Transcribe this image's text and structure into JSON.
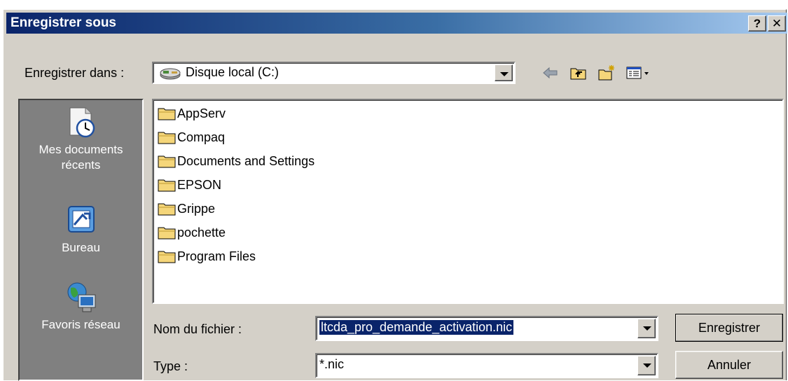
{
  "window": {
    "title": "Enregistrer sous",
    "help_label": "?",
    "close_label": "✕"
  },
  "save_in": {
    "label": "Enregistrer dans :",
    "value": "Disque local (C:)",
    "icon": "drive-icon"
  },
  "toolbar": {
    "back": "back-arrow-icon",
    "up": "up-folder-icon",
    "new_folder": "new-folder-icon",
    "view": "view-menu-icon"
  },
  "places": [
    {
      "label": "Mes documents récents",
      "icon": "recent-documents-icon"
    },
    {
      "label": "Bureau",
      "icon": "desktop-icon"
    },
    {
      "label": "Favoris réseau",
      "icon": "network-icon"
    }
  ],
  "files": [
    "AppServ",
    "Compaq",
    "Documents and Settings",
    "EPSON",
    "Grippe",
    "pochette",
    "Program Files"
  ],
  "filename": {
    "label": "Nom du fichier :",
    "value": "ltcda_pro_demande_activation.nic"
  },
  "filetype": {
    "label": "Type :",
    "value": "*.nic"
  },
  "buttons": {
    "save": "Enregistrer",
    "cancel": "Annuler"
  },
  "colors": {
    "title_start": "#0a246a",
    "title_end": "#a6caf0",
    "face": "#d4d0c8",
    "places_bg": "#808080",
    "folder": "#f5d67a"
  }
}
